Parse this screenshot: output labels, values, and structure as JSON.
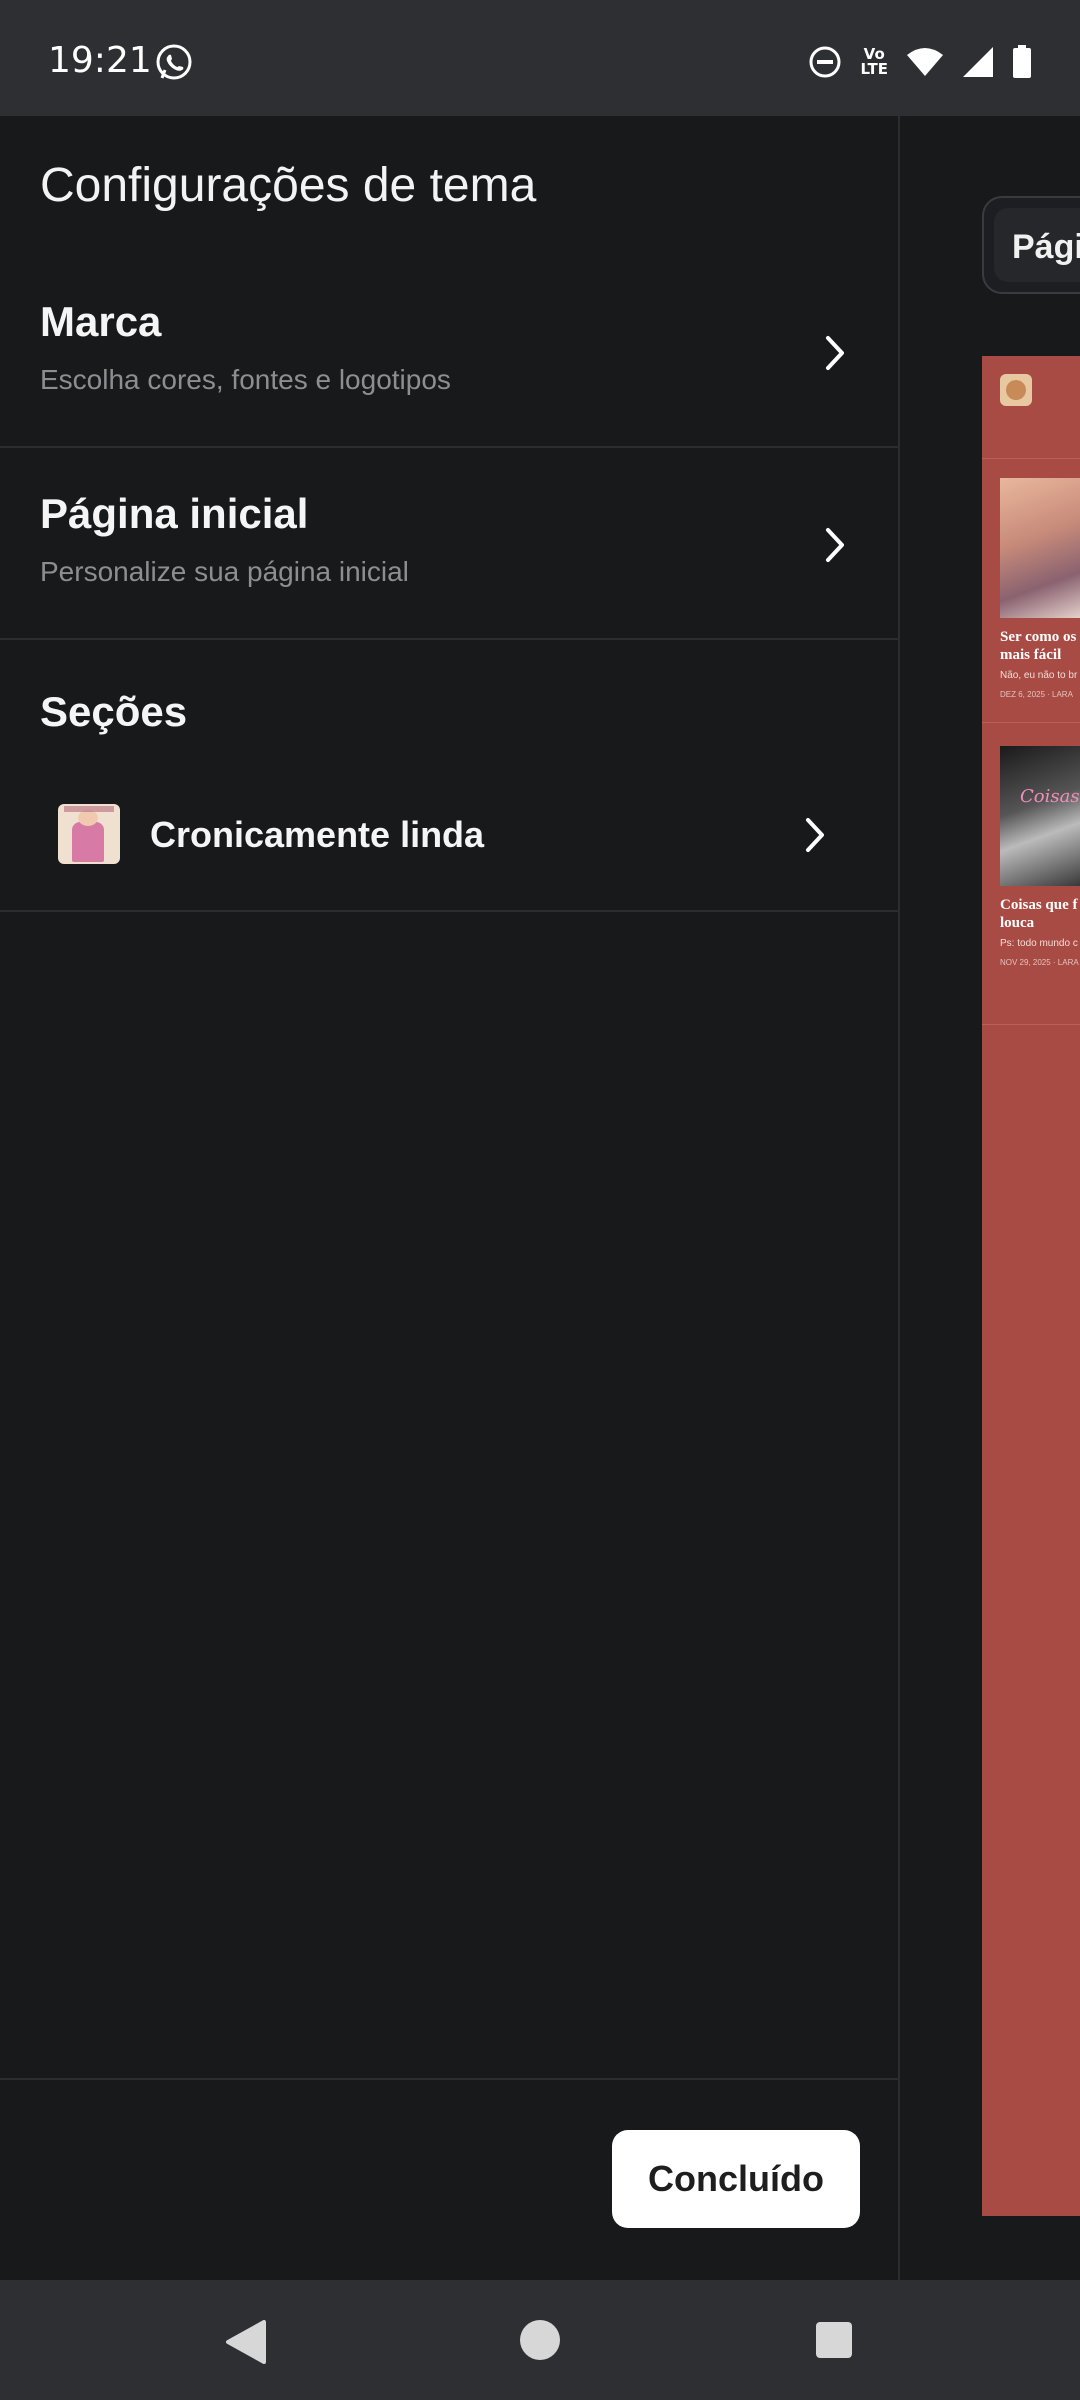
{
  "status_bar": {
    "time": "19:21",
    "icons": [
      "whatsapp-icon",
      "do-not-disturb-icon",
      "volte-icon",
      "wifi-icon",
      "signal-icon",
      "battery-icon"
    ],
    "volte_text_top": "Vo",
    "volte_text_bottom": "LTE"
  },
  "drawer": {
    "title": "Configurações de tema",
    "items": [
      {
        "title": "Marca",
        "subtitle": "Escolha cores, fontes e logotipos",
        "icon": "chevron-right-icon"
      },
      {
        "title": "Página inicial",
        "subtitle": "Personalize sua página inicial",
        "icon": "chevron-right-icon"
      }
    ],
    "sections": {
      "title": "Seções",
      "items": [
        {
          "label": "Cronicamente linda",
          "icon": "chevron-right-icon"
        }
      ]
    },
    "done_button": "Concluído"
  },
  "preview": {
    "tab_label": "Págin",
    "posts": [
      {
        "title_line1": "Ser como os",
        "title_line2": "mais fácil",
        "subtitle": "Não, eu não to br",
        "meta": "DEZ 6, 2025 · LARA"
      },
      {
        "title_line1": "Coisas que f",
        "title_line2": "louca",
        "subtitle": "Ps: todo mundo c",
        "meta": "NOV 29, 2025 · LARA"
      }
    ]
  },
  "colors": {
    "background": "#18191b",
    "bars": "#2e2f33",
    "preview_accent": "#a84b44",
    "button_bg": "#ffffff"
  },
  "nav_bar": {
    "icons": [
      "back-icon",
      "home-icon",
      "recents-icon"
    ]
  }
}
